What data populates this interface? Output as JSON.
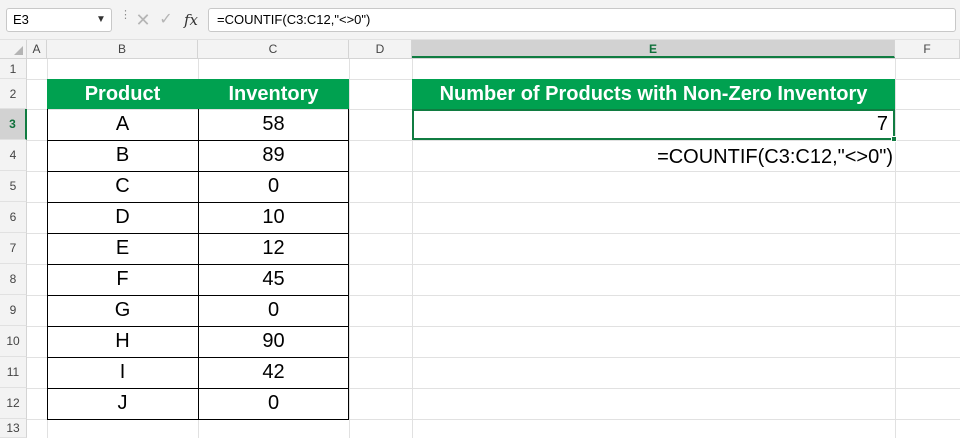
{
  "formula_bar": {
    "name_box": "E3",
    "dropdown_icon": "chevron-down-icon",
    "cancel_glyph": "✕",
    "enter_glyph": "✓",
    "fx_label": "fx",
    "formula": "=COUNTIF(C3:C12,\"<>0\")"
  },
  "columns": [
    "A",
    "B",
    "C",
    "D",
    "E",
    "F"
  ],
  "rows": [
    "1",
    "2",
    "3",
    "4",
    "5",
    "6",
    "7",
    "8",
    "9",
    "10",
    "11",
    "12",
    "13"
  ],
  "table": {
    "headers": [
      "Product",
      "Inventory"
    ],
    "rows": [
      {
        "product": "A",
        "inventory": "58"
      },
      {
        "product": "B",
        "inventory": "89"
      },
      {
        "product": "C",
        "inventory": "0"
      },
      {
        "product": "D",
        "inventory": "10"
      },
      {
        "product": "E",
        "inventory": "12"
      },
      {
        "product": "F",
        "inventory": "45"
      },
      {
        "product": "G",
        "inventory": "0"
      },
      {
        "product": "H",
        "inventory": "90"
      },
      {
        "product": "I",
        "inventory": "42"
      },
      {
        "product": "J",
        "inventory": "0"
      }
    ]
  },
  "result": {
    "header": "Number of Products with Non-Zero Inventory",
    "value": "7",
    "formula_text": "=COUNTIF(C3:C12,\"<>0\")"
  },
  "colors": {
    "header_green": "#00a150",
    "selection_green": "#107c41"
  }
}
